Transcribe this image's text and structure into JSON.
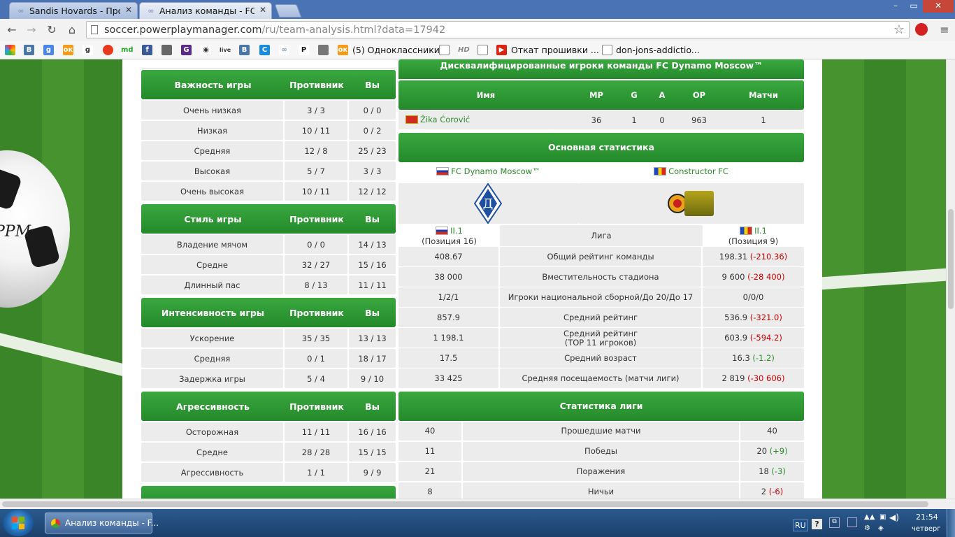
{
  "browser": {
    "tabs": [
      {
        "title": "Sandis Hovards - Проф",
        "active": false
      },
      {
        "title": "Анализ команды - FC D",
        "active": true
      }
    ],
    "window_controls": {
      "minimize": "–",
      "maximize": "▭",
      "close": "✕"
    },
    "url_host": "soccer.powerplaymanager.com",
    "url_path": "/ru/team-analysis.html?data=17942",
    "bookmarks": [
      {
        "label": "(5) Одноклассники"
      },
      {
        "label": "Откат прошивки ..."
      },
      {
        "label": "don-jons-addictio..."
      }
    ]
  },
  "left_tables": [
    {
      "header": {
        "title": "Важность игры",
        "col_opp": "Противник",
        "col_you": "Вы"
      },
      "rows": [
        {
          "label": "Очень низкая",
          "opp": "3 / 3",
          "you": "0 / 0"
        },
        {
          "label": "Низкая",
          "opp": "10 / 11",
          "you": "0 / 2"
        },
        {
          "label": "Средняя",
          "opp": "12 / 8",
          "you": "25 / 23"
        },
        {
          "label": "Высокая",
          "opp": "5 / 7",
          "you": "3 / 3"
        },
        {
          "label": "Очень высокая",
          "opp": "10 / 11",
          "you": "12 / 12"
        }
      ]
    },
    {
      "header": {
        "title": "Стиль игры",
        "col_opp": "Противник",
        "col_you": "Вы"
      },
      "rows": [
        {
          "label": "Владение мячом",
          "opp": "0 / 0",
          "you": "14 / 13"
        },
        {
          "label": "Средне",
          "opp": "32 / 27",
          "you": "15 / 16"
        },
        {
          "label": "Длинный пас",
          "opp": "8 / 13",
          "you": "11 / 11"
        }
      ]
    },
    {
      "header": {
        "title": "Интенсивность игры",
        "col_opp": "Противник",
        "col_you": "Вы"
      },
      "rows": [
        {
          "label": "Ускорение",
          "opp": "35 / 35",
          "you": "13 / 13"
        },
        {
          "label": "Средняя",
          "opp": "0 / 1",
          "you": "18 / 17"
        },
        {
          "label": "Задержка игры",
          "opp": "5 / 4",
          "you": "9 / 10"
        }
      ]
    },
    {
      "header": {
        "title": "Агрессивность",
        "col_opp": "Противник",
        "col_you": "Вы"
      },
      "rows": [
        {
          "label": "Осторожная",
          "opp": "11 / 11",
          "you": "16 / 16"
        },
        {
          "label": "Средне",
          "opp": "28 / 28",
          "you": "15 / 15"
        },
        {
          "label": "Агрессивность",
          "opp": "1 / 1",
          "you": "9 / 9"
        }
      ]
    }
  ],
  "disqualified": {
    "title": "Дисквалифицированные игроки команды FC Dynamo Moscow™",
    "columns": [
      "Имя",
      "MP",
      "G",
      "A",
      "OP",
      "Матчи"
    ],
    "rows": [
      {
        "name": "Žika Ćorović",
        "mp": "36",
        "g": "1",
        "a": "0",
        "op": "963",
        "matches": "1"
      }
    ]
  },
  "main_stats": {
    "title": "Основная статистика",
    "team_left": "FC Dynamo Moscow™",
    "team_right": "Constructor FC",
    "league_left": "II.1",
    "league_left_pos": "(Позиция 16)",
    "league_right": "II.1",
    "league_right_pos": "(Позиция 9)",
    "league_label": "Лига",
    "rows": [
      {
        "left": "408.67",
        "label": "Общий рейтинг команды",
        "right": "198.31",
        "diff": "(-210.36)",
        "diff_type": "neg"
      },
      {
        "left": "38 000",
        "label": "Вместительность стадиона",
        "right": "9 600",
        "diff": "(-28 400)",
        "diff_type": "neg"
      },
      {
        "left": "1/2/1",
        "label": "Игроки национальной сборной/До 20/До 17",
        "right": "0/0/0",
        "diff": "",
        "diff_type": ""
      },
      {
        "left": "857.9",
        "label": "Средний рейтинг",
        "right": "536.9",
        "diff": "(-321.0)",
        "diff_type": "neg"
      },
      {
        "left": "1 198.1",
        "label": "Средний рейтинг",
        "label2": "(TOP 11 игроков)",
        "right": "603.9",
        "diff": "(-594.2)",
        "diff_type": "neg"
      },
      {
        "left": "17.5",
        "label": "Средний возраст",
        "right": "16.3",
        "diff": "(-1.2)",
        "diff_type": "pos"
      },
      {
        "left": "33 425",
        "label": "Средняя посещаемость (матчи лиги)",
        "right": "2 819",
        "diff": "(-30 606)",
        "diff_type": "neg"
      }
    ]
  },
  "league_stats": {
    "title": "Статистика лиги",
    "rows": [
      {
        "left": "40",
        "label": "Прошедшие матчи",
        "right": "40",
        "diff": "",
        "diff_type": ""
      },
      {
        "left": "11",
        "label": "Победы",
        "right": "20",
        "diff": "(+9)",
        "diff_type": "pos"
      },
      {
        "left": "21",
        "label": "Поражения",
        "right": "18",
        "diff": "(-3)",
        "diff_type": "pos"
      },
      {
        "left": "8",
        "label": "Ничьи",
        "right": "2",
        "diff": "(-6)",
        "diff_type": "neg"
      }
    ]
  },
  "taskbar": {
    "task_label": "Анализ команды - F...",
    "lang": "RU",
    "time": "21:54",
    "day": "четверг"
  },
  "colors": {
    "header_green": "#2b9a32",
    "negative": "#cc0000",
    "positive": "#2b8a2b"
  }
}
